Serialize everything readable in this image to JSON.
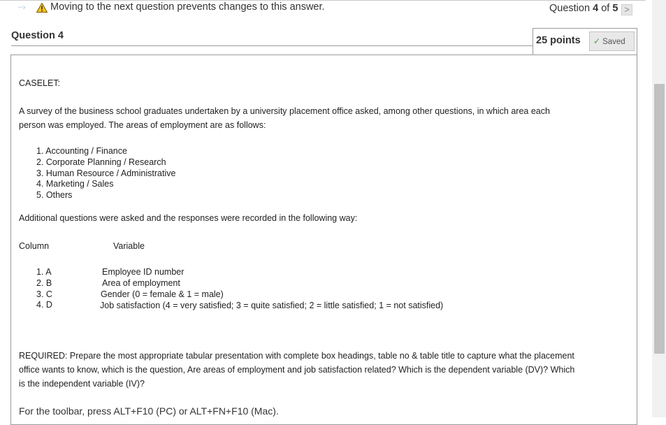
{
  "header": {
    "nav_icon": "arrow-right-icon",
    "warning_icon": "warning-triangle-icon",
    "warning_text": "Moving to the next question prevents changes to this answer.",
    "question_prefix": "Question",
    "question_current": "4",
    "question_of": "of",
    "question_total": "5",
    "next_symbol": ">"
  },
  "question": {
    "title": "Question 4",
    "points": "25 points",
    "saved_check": "✓",
    "saved_label": "Saved"
  },
  "body": {
    "caselet": "CASELET:",
    "intro_line1": "A survey of the business school graduates undertaken by a university placement office asked, among other questions, in which area each",
    "intro_line2": "person was employed.  The areas of employment are as follows:",
    "areas": [
      "1. Accounting / Finance",
      "2. Corporate Planning / Research",
      "3. Human Resource / Administrative",
      "4. Marketing / Sales",
      "5. Others"
    ],
    "additional": "Additional questions were asked and the responses were recorded in the following way:",
    "column_header": "Column",
    "variable_header": "Variable",
    "columns": [
      "1. A",
      "2. B",
      "3. C",
      "4. D"
    ],
    "variables": [
      "Employee ID number",
      "Area of employment",
      "Gender (0 = female  &  1 = male)",
      "Job satisfaction (4 = very satisfied;  3 = quite satisfied;  2 = little satisfied;   1 = not satisfied)"
    ],
    "required_line1": "REQUIRED: Prepare the most appropriate tabular presentation  with complete box headings, table no & table title to capture what the placement",
    "required_line2": "office wants to know, which is the question, Are areas of employment and job satisfaction related? Which is the dependent variable (DV)?  Which",
    "required_line3": "is the independent variable (IV)?",
    "toolbar_hint": "For the toolbar, press ALT+F10 (PC) or ALT+FN+F10 (Mac)."
  }
}
